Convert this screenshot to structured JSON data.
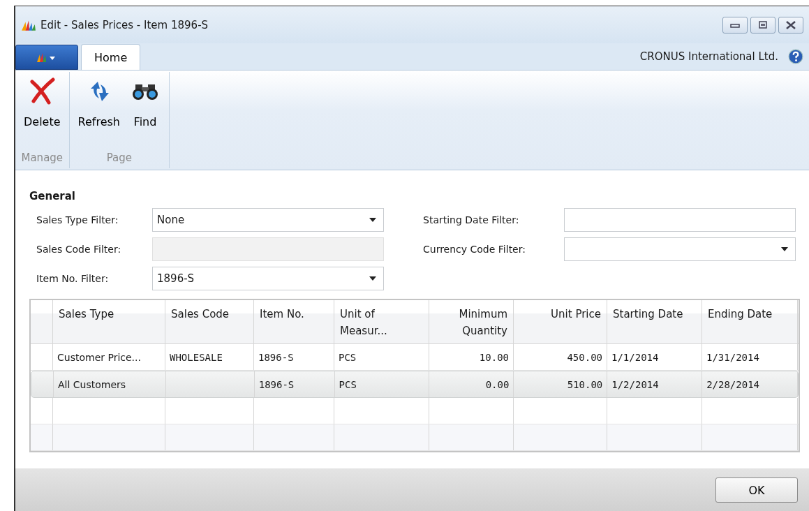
{
  "window": {
    "title": "Edit - Sales Prices - Item 1896-S"
  },
  "tabs": [
    {
      "label": "Home",
      "selected": true
    }
  ],
  "company": "CRONUS International Ltd.",
  "ribbon": {
    "groups": [
      {
        "label": "Manage",
        "buttons": [
          {
            "label": "Delete",
            "kind": "delete"
          }
        ]
      },
      {
        "label": "Page",
        "buttons": [
          {
            "label": "Refresh",
            "kind": "refresh"
          },
          {
            "label": "Find",
            "kind": "find"
          }
        ]
      }
    ]
  },
  "general": {
    "title": "General",
    "left_fields": [
      {
        "label": "Sales Type Filter:",
        "kind": "dropdown",
        "value": "None",
        "disabled": false
      },
      {
        "label": "Sales Code Filter:",
        "kind": "text",
        "disabled": true
      },
      {
        "label": "Item No. Filter:",
        "kind": "dropdown",
        "value": "1896-S",
        "disabled": false
      }
    ],
    "right_fields": [
      {
        "label": "Starting Date Filter:",
        "kind": "text",
        "disabled": false
      },
      {
        "label": "Currency Code Filter:",
        "kind": "dropdown",
        "disabled": false
      }
    ]
  },
  "table": {
    "columns": [
      {
        "label": "Sales Type"
      },
      {
        "label": "Sales Code"
      },
      {
        "label": "Item No."
      },
      {
        "label": "Unit of Measur..."
      },
      {
        "label": "Minimum Quantity"
      },
      {
        "label": "Unit Price"
      },
      {
        "label": "Starting Date"
      },
      {
        "label": "Ending Date"
      }
    ],
    "rows": [
      {
        "selected": false,
        "cells": [
          "Customer Price...",
          "WHOLESALE",
          "1896-S",
          "PCS",
          "10.00",
          "450.00",
          "1/1/2014",
          "1/31/2014"
        ]
      },
      {
        "selected": true,
        "cells": [
          "All Customers",
          "",
          "1896-S",
          "PCS",
          "0.00",
          "510.00",
          "1/2/2014",
          "2/28/2014"
        ]
      }
    ]
  },
  "buttons": [
    {
      "label": "OK"
    }
  ]
}
